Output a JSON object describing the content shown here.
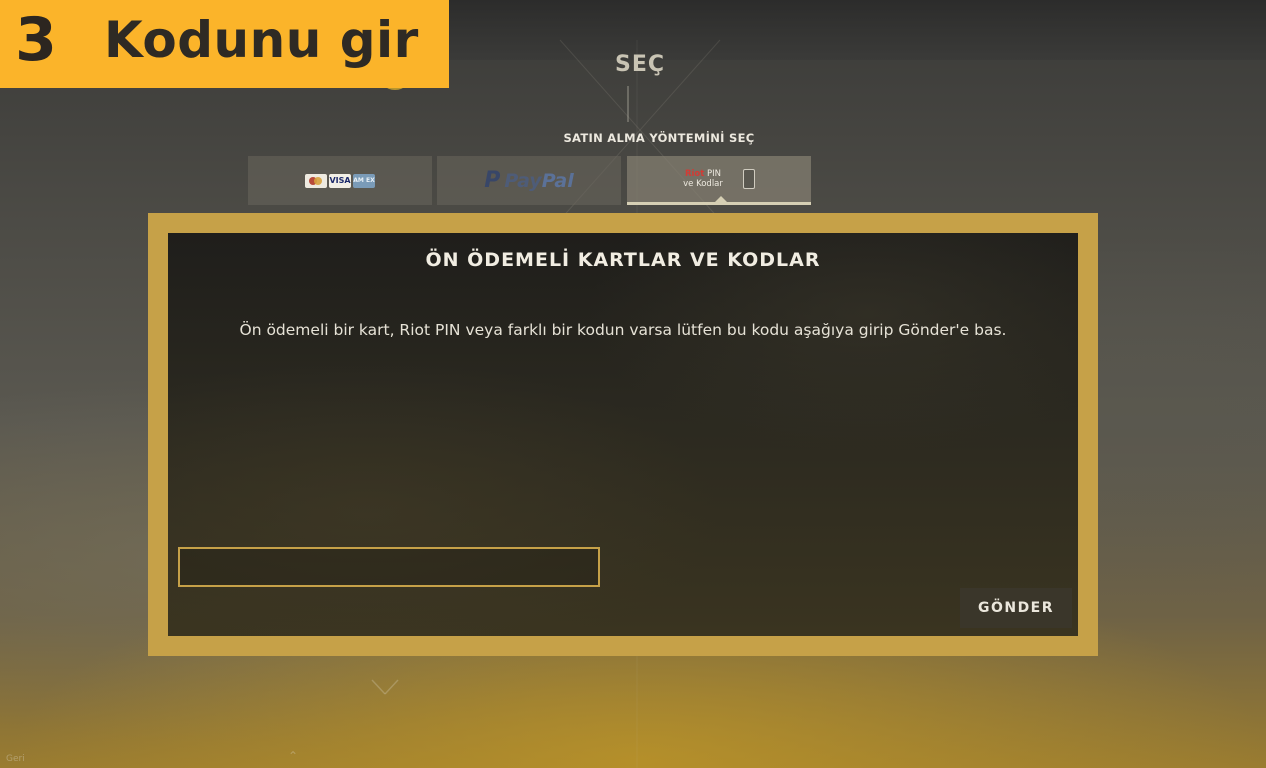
{
  "colors": {
    "accent_gold": "#c6a148",
    "banner_yellow": "#fbb42a",
    "modal_bg": "#26241f",
    "button_bg": "#3a362a"
  },
  "banner": {
    "number": "3",
    "title": "Kodunu gir"
  },
  "header": {
    "title": "SEÇ",
    "back_icon": "chevron-left-icon"
  },
  "payment": {
    "label": "SATIN ALMA YÖNTEMİNİ SEÇ",
    "tabs": [
      {
        "id": "cards",
        "icons": [
          "mastercard-icon",
          "visa-icon",
          "amex-icon"
        ],
        "visa_text": "VISA",
        "amex_text": "AM EX",
        "selected": false
      },
      {
        "id": "paypal",
        "pp_text": "P",
        "pay_text": "Pay",
        "pal_text": "Pal",
        "selected": false
      },
      {
        "id": "codes",
        "riot_text": "Riot",
        "pin_text": "PIN",
        "line2": "ve Kodlar",
        "selected": true
      }
    ]
  },
  "modal": {
    "title": "ÖN ÖDEMELİ KARTLAR VE KODLAR",
    "description": "Ön ödemeli bir kart, Riot PIN veya farklı bir kodun varsa lütfen bu kodu aşağıya girip Gönder'e bas.",
    "input_value": "",
    "input_placeholder": "",
    "submit_label": "GÖNDER"
  },
  "footer": {
    "hint_text": "Geri"
  }
}
